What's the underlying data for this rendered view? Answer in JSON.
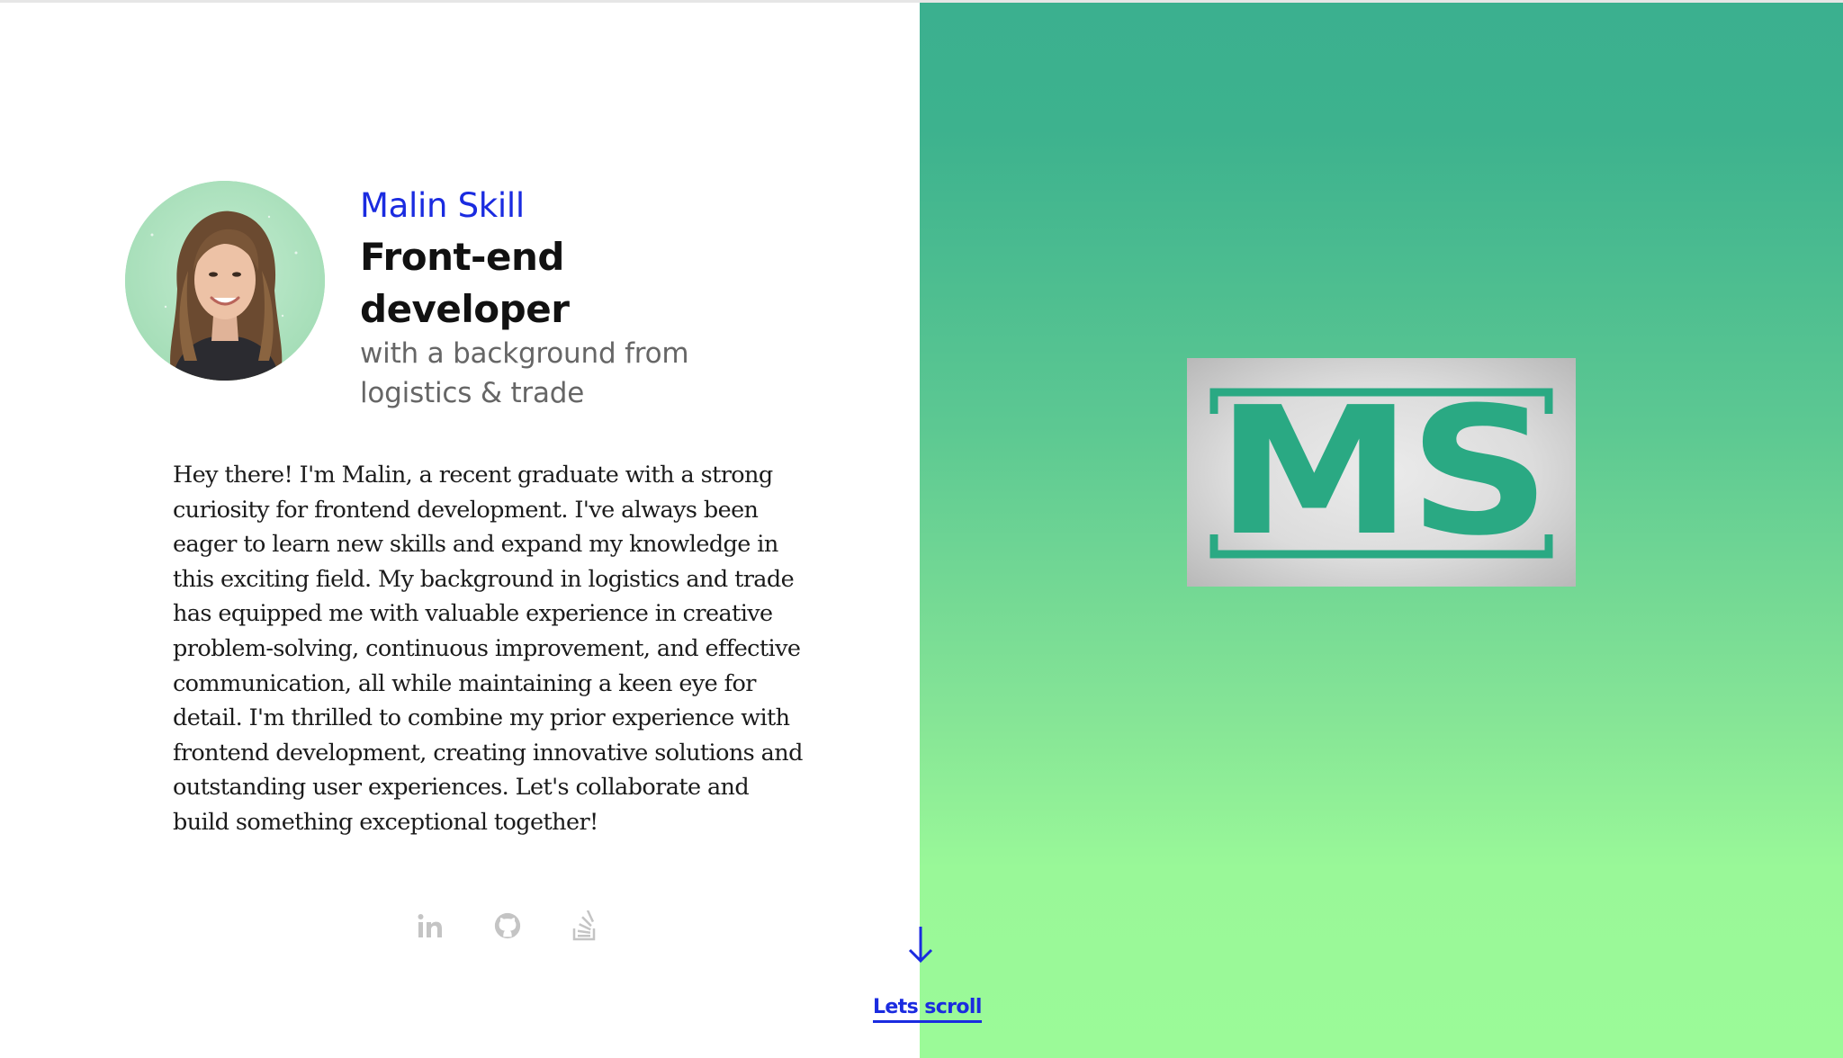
{
  "profile": {
    "name": "Malin Skill",
    "role": "Front-end developer",
    "tagline": "with a background from logistics & trade",
    "avatar_icon": "portrait-photo"
  },
  "bio": "Hey there! I'm Malin, a recent graduate with a strong curiosity for frontend development. I've always been eager to learn new skills and expand my knowledge in this exciting field. My background in logistics and trade has equipped me with valuable experience in creative problem-solving, continuous improvement, and effective communication, all while maintaining a keen eye for detail. I'm thrilled to combine my prior experience with frontend development, creating innovative solutions and outstanding user experiences. Let's collaborate and build something exceptional together!",
  "socials": [
    {
      "icon": "linkedin-icon",
      "label": "LinkedIn"
    },
    {
      "icon": "github-icon",
      "label": "GitHub"
    },
    {
      "icon": "stackoverflow-icon",
      "label": "Stack Overflow"
    }
  ],
  "scroll": {
    "label": "Lets scroll",
    "icon": "arrow-down-icon"
  },
  "logo": {
    "text": "MS"
  },
  "colors": {
    "accent": "#1a2be0",
    "logo_green": "#2aa983",
    "gradient_top": "#3bb08f",
    "gradient_bottom": "#9bfa98",
    "icon_gray": "#c4c4c4"
  }
}
